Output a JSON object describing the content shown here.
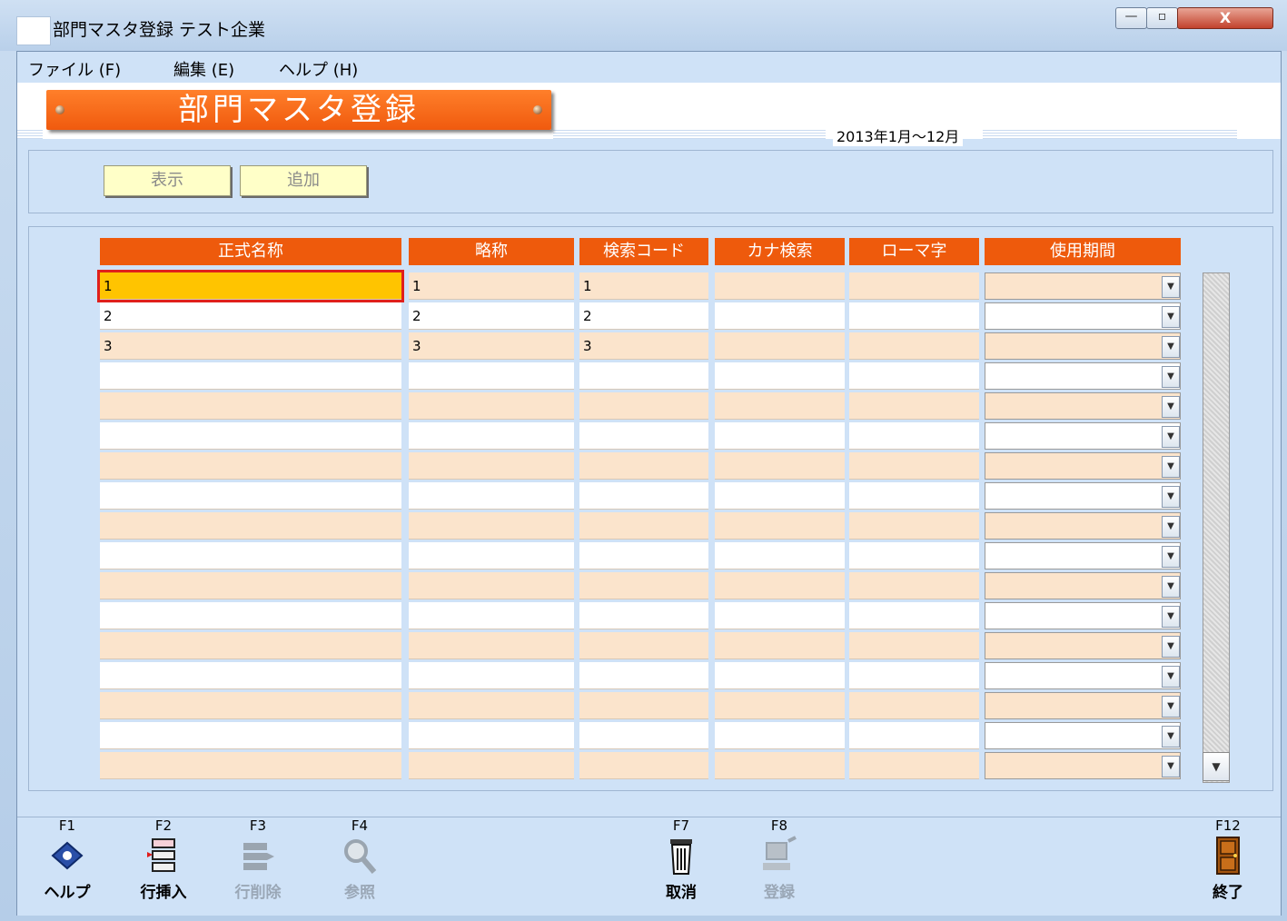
{
  "window": {
    "title": "部門マスタ登録 テスト企業",
    "minimize": "—",
    "maximize": "▫",
    "close": "X"
  },
  "menu": [
    "ファイル (F)",
    "編集 (E)",
    "ヘルプ (H)"
  ],
  "banner": {
    "title": "部門マスタ登録"
  },
  "period": "2013年1月～12月",
  "buttons": {
    "show": "表示",
    "add": "追加"
  },
  "grid": {
    "columns": [
      "正式名称",
      "略称",
      "検索コード",
      "カナ検索",
      "ローマ字",
      "使用期間"
    ],
    "rows": [
      {
        "name": "1",
        "short": "1",
        "code": "1",
        "kana": "",
        "roman": "",
        "period": ""
      },
      {
        "name": "2",
        "short": "2",
        "code": "2",
        "kana": "",
        "roman": "",
        "period": ""
      },
      {
        "name": "3",
        "short": "3",
        "code": "3",
        "kana": "",
        "roman": "",
        "period": ""
      }
    ],
    "total_rows": 17
  },
  "fkeys": [
    {
      "key": "F1",
      "label": "ヘルプ",
      "icon": "help-book-icon",
      "enabled": true
    },
    {
      "key": "F2",
      "label": "行挿入",
      "icon": "insert-row-icon",
      "enabled": true
    },
    {
      "key": "F3",
      "label": "行削除",
      "icon": "delete-row-icon",
      "enabled": false
    },
    {
      "key": "F4",
      "label": "参照",
      "icon": "magnifier-icon",
      "enabled": false
    },
    {
      "key": "F7",
      "label": "取消",
      "icon": "trash-icon",
      "enabled": true
    },
    {
      "key": "F8",
      "label": "登録",
      "icon": "register-computer-icon",
      "enabled": false
    },
    {
      "key": "F12",
      "label": "終了",
      "icon": "exit-door-icon",
      "enabled": true
    }
  ]
}
